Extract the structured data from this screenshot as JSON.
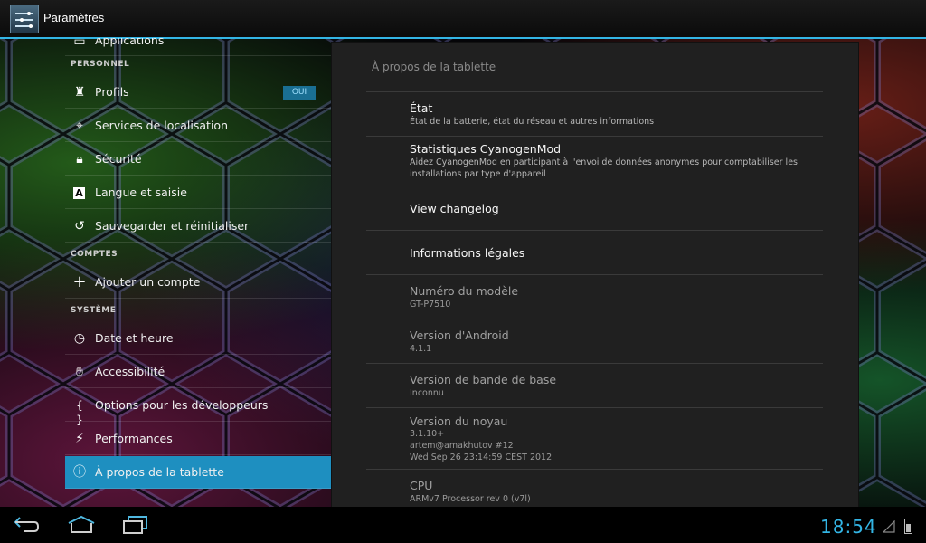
{
  "action_bar": {
    "title": "Paramètres"
  },
  "left_pane": {
    "partial_item": "Applications",
    "headers": {
      "personnel": "PERSONNEL",
      "comptes": "COMPTES",
      "systeme": "SYSTÈME"
    },
    "items": [
      {
        "label": "Profils",
        "icon": "profiles-icon"
      },
      {
        "label": "Services de localisation",
        "icon": "location-icon"
      },
      {
        "label": "Sécurité",
        "icon": "lock-icon"
      },
      {
        "label": "Langue et saisie",
        "icon": "language-icon"
      },
      {
        "label": "Sauvegarder et réinitialiser",
        "icon": "backup-icon"
      },
      {
        "label": "Ajouter un compte",
        "icon": "add-icon"
      },
      {
        "label": "Date et heure",
        "icon": "clock-icon"
      },
      {
        "label": "Accessibilité",
        "icon": "hand-icon"
      },
      {
        "label": "Options pour les développeurs",
        "icon": "braces-icon"
      },
      {
        "label": "Performances",
        "icon": "performance-icon"
      },
      {
        "label": "À propos de la tablette",
        "icon": "info-icon"
      }
    ],
    "profiles_toggle": "OUI"
  },
  "right_pane": {
    "title": "À propos de la tablette",
    "items": [
      {
        "title": "État",
        "summary": "État de la batterie, état du réseau et autres informations"
      },
      {
        "title": "Statistiques CyanogenMod",
        "summary": "Aidez CyanogenMod en participant à l'envoi de données anonymes pour comptabiliser les installations par type d'appareil"
      },
      {
        "title": "View changelog",
        "summary": ""
      },
      {
        "title": "Informations légales",
        "summary": ""
      },
      {
        "title": "Numéro du modèle",
        "summary": "GT-P7510"
      },
      {
        "title": "Version d'Android",
        "summary": "4.1.1"
      },
      {
        "title": "Version de bande de base",
        "summary": "Inconnu"
      },
      {
        "title": "Version du noyau",
        "summary_lines": [
          "3.1.10+",
          "artem@amakhutov #12",
          "Wed Sep 26 23:14:59 CEST 2012"
        ]
      },
      {
        "title": "CPU",
        "summary": "ARMv7 Processor rev 0 (v7l)"
      }
    ]
  },
  "status_bar": {
    "time": "18:54"
  },
  "colors": {
    "accent": "#33b5e5",
    "selected": "#1e8fc0"
  }
}
